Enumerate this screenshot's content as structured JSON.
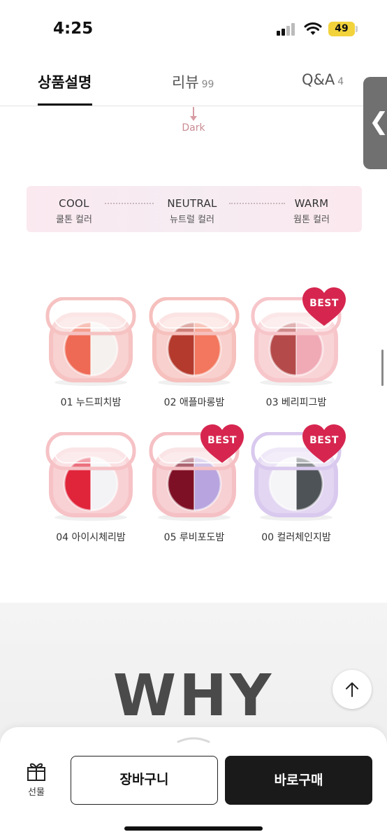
{
  "status_bar": {
    "time": "4:25",
    "battery": "49"
  },
  "tabs": [
    {
      "label": "상품설명",
      "count": "",
      "active": true
    },
    {
      "label": "리뷰",
      "count": "99",
      "active": false
    },
    {
      "label": "Q&A",
      "count": "4",
      "active": false
    }
  ],
  "side_handle": {
    "glyph": "❮"
  },
  "shade_scale": {
    "dark_label": "Dark"
  },
  "tones": [
    {
      "en": "COOL",
      "ko": "쿨톤 컬러"
    },
    {
      "en": "NEUTRAL",
      "ko": "뉴트럴 컬러"
    },
    {
      "en": "WARM",
      "ko": "웜톤 컬러"
    }
  ],
  "products": [
    {
      "name": "01 누드피치밤",
      "best": false,
      "left_color": "#ee6a55",
      "right_color": "#f4f1ee",
      "case_color": "#f6c2c2"
    },
    {
      "name": "02 애플마롱밤",
      "best": false,
      "left_color": "#b43a2e",
      "right_color": "#f2775e",
      "case_color": "#f6c0bd"
    },
    {
      "name": "03 베리피그밤",
      "best": true,
      "left_color": "#b54a4a",
      "right_color": "#f0aab6",
      "case_color": "#f7c6ca"
    },
    {
      "name": "04 아이시체리밤",
      "best": false,
      "left_color": "#e0243a",
      "right_color": "#f3f3f6",
      "case_color": "#f6c2c6"
    },
    {
      "name": "05 루비포도밤",
      "best": true,
      "left_color": "#7e1025",
      "right_color": "#b8a4de",
      "case_color": "#f5c0c4"
    },
    {
      "name": "00 컬러체인지밤",
      "best": true,
      "left_color": "#f5f5f7",
      "right_color": "#4e5358",
      "case_color": "#d9c9ee"
    }
  ],
  "best_badge": {
    "label": "BEST",
    "color": "#d6264f"
  },
  "why_section": {
    "title": "WHY"
  },
  "bottom_bar": {
    "gift_label": "선물",
    "cart_label": "장바구니",
    "buy_label": "바로구매"
  },
  "icons": {
    "gift": "gift-icon",
    "scroll_top": "arrow-up-icon",
    "back": "chevron-left-icon"
  }
}
